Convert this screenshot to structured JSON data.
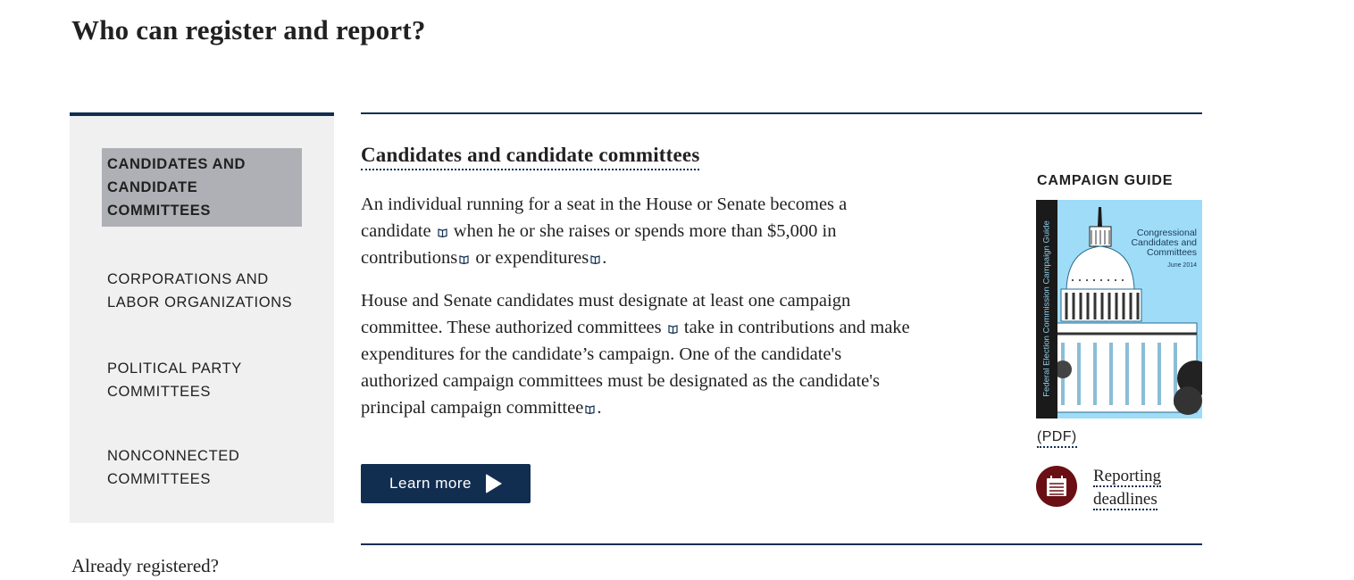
{
  "page": {
    "title": "Who can register and report?"
  },
  "sidebar": {
    "items": [
      {
        "label": "Candidates and candidate committees",
        "active": true
      },
      {
        "label": "Corporations and labor organizations",
        "active": false
      },
      {
        "label": "Political party committees",
        "active": false
      },
      {
        "label": "Nonconnected committees",
        "active": false
      }
    ],
    "already_registered": "Already registered?"
  },
  "main": {
    "section_title": "Candidates and candidate committees",
    "paragraph1": {
      "part1": "An individual running for a seat in the House or Senate becomes a candidate",
      "part2": "when he or she raises or spends more than $5,000 in contributions",
      "part3": "or expenditures",
      "part4": "."
    },
    "paragraph2": {
      "part1": "House and Senate candidates must designate at least one campaign committee. These authorized committees",
      "part2": "take in contributions and make expenditures for the candidate’s campaign. One of the candidate's authorized campaign committees must be designated as the candidate's principal campaign committee",
      "part3": "."
    },
    "glossary_icon": "book-icon",
    "learn_more_label": "Learn more"
  },
  "aside": {
    "guide_label": "CAMPAIGN GUIDE",
    "cover": {
      "spine_text": "Federal Election Commission Campaign Guide",
      "title_lines": [
        "Congressional",
        "Candidates and",
        "Committees"
      ],
      "date": "June 2014"
    },
    "pdf_label": "(PDF)",
    "deadlines_label_line1": "Reporting",
    "deadlines_label_line2": "deadlines",
    "deadlines_icon": "calendar-icon"
  },
  "colors": {
    "navy": "#112e51",
    "sidebar_bg": "#f0f0f0",
    "active_bg": "#aeb0b5",
    "maroon": "#6a1014",
    "cover_blue": "#9fdcf7"
  }
}
